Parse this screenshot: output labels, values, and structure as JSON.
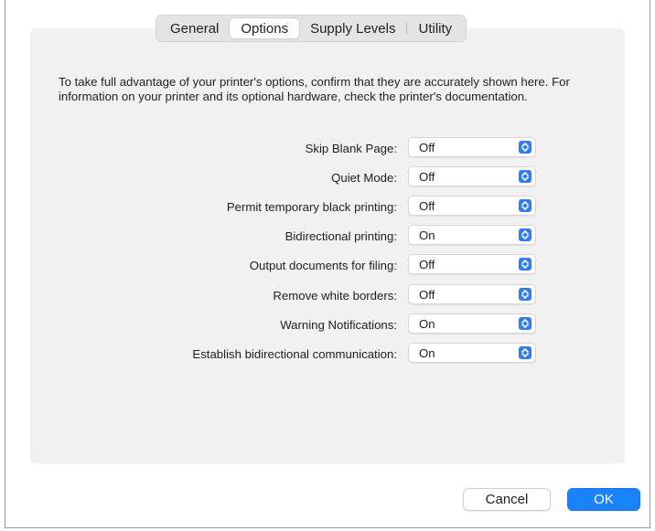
{
  "tabs": [
    {
      "label": "General",
      "active": false
    },
    {
      "label": "Options",
      "active": true
    },
    {
      "label": "Supply Levels",
      "active": false
    },
    {
      "label": "Utility",
      "active": false
    }
  ],
  "description": "To take full advantage of your printer's options, confirm that they are accurately shown here. For information on your printer and its optional hardware, check the printer's documentation.",
  "options": [
    {
      "label": "Skip Blank Page:",
      "value": "Off"
    },
    {
      "label": "Quiet Mode:",
      "value": "Off"
    },
    {
      "label": "Permit temporary black printing:",
      "value": "Off"
    },
    {
      "label": "Bidirectional printing:",
      "value": "On"
    },
    {
      "label": "Output documents for filing:",
      "value": "Off"
    },
    {
      "label": "Remove white borders:",
      "value": "Off"
    },
    {
      "label": "Warning Notifications:",
      "value": "On"
    },
    {
      "label": "Establish bidirectional communication:",
      "value": "On"
    }
  ],
  "buttons": {
    "cancel_label": "Cancel",
    "ok_label": "OK"
  },
  "colors": {
    "accent": "#1a82fb",
    "stepper": "#2f7cf6",
    "panel": "#f1f1f1"
  },
  "icons": {
    "popup_stepper": "chevron-up-down-icon"
  }
}
